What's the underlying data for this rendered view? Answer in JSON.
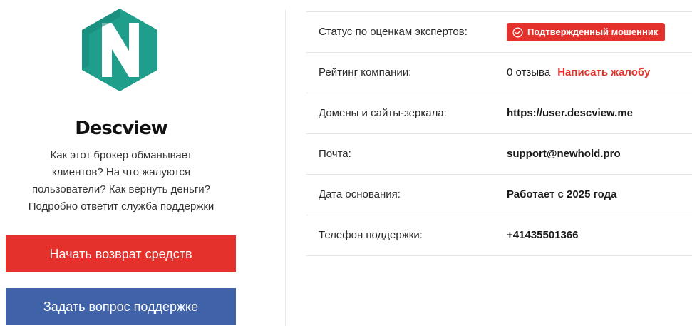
{
  "broker": {
    "name": "Descview",
    "description_lines": [
      "Как этот брокер обманывает",
      "клиентов? На что жалуются",
      "пользователи? Как вернуть деньги?",
      "Подробно ответит служба поддержки"
    ],
    "logo_icon": "descview-logo-icon",
    "logo_color": "#1f9e8c"
  },
  "buttons": {
    "refund_label": "Начать возврат средств",
    "ask_label": "Задать вопрос поддержке"
  },
  "info": {
    "status": {
      "label": "Статус по оценкам экспертов:",
      "badge": "Подтвержденный мошенник",
      "badge_icon": "check-circle-icon"
    },
    "rating": {
      "label": "Рейтинг компании:",
      "reviews": "0 отзыва",
      "complaint_link": "Написать жалобу"
    },
    "domains": {
      "label": "Домены и сайты-зеркала:",
      "value": "https://user.descview.me"
    },
    "email": {
      "label": "Почта:",
      "value": "support@newhold.pro"
    },
    "founded": {
      "label": "Дата основания:",
      "value": "Работает с 2025 года"
    },
    "phone": {
      "label": "Телефон поддержки:",
      "value": "+41435501366"
    }
  },
  "colors": {
    "accent_red": "#e4312b",
    "accent_blue": "#3f62a8",
    "logo_teal": "#1f9e8c"
  }
}
